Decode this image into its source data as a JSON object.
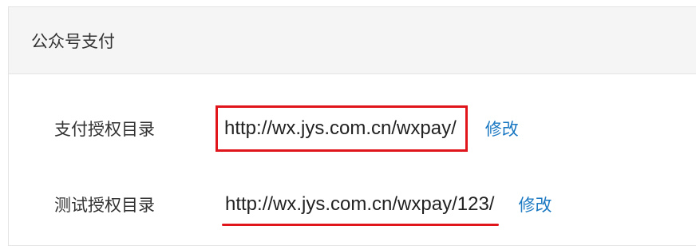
{
  "panel": {
    "title": "公众号支付"
  },
  "rows": [
    {
      "label": "支付授权目录",
      "url": "http://wx.jys.com.cn/wxpay/",
      "action": "修改",
      "highlight": "box",
      "highlight_color": "#e0151c"
    },
    {
      "label": "测试授权目录",
      "url": "http://wx.jys.com.cn/wxpay/123/",
      "action": "修改",
      "highlight": "underline",
      "highlight_color": "#e0151c"
    }
  ],
  "colors": {
    "header_bg": "#f5f5f5",
    "link": "#1a78c2",
    "text": "#333333",
    "border": "#e4e4e4"
  }
}
